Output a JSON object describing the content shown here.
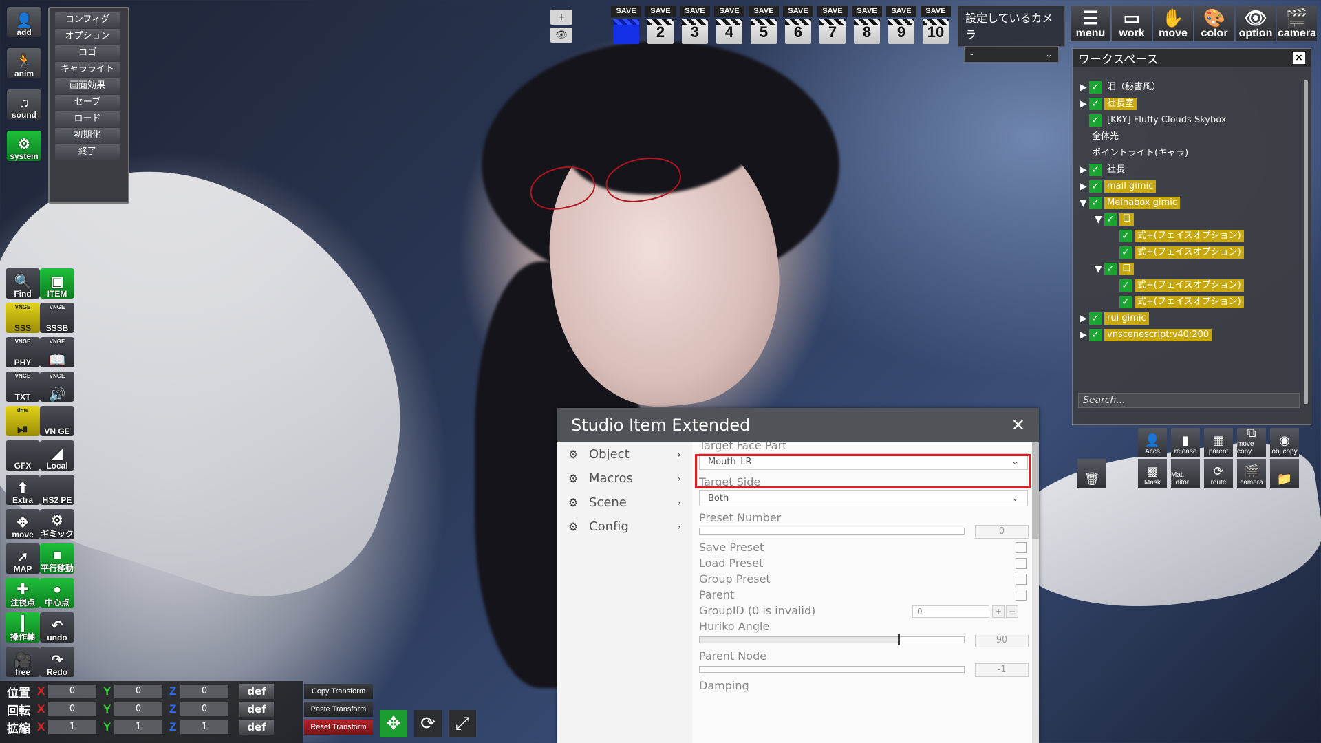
{
  "system_menu": {
    "items": [
      "コンフィグ",
      "オプション",
      "ロゴ",
      "キャラライト",
      "画面効果",
      "セーブ",
      "ロード",
      "初期化",
      "終了"
    ]
  },
  "left_toolbar": {
    "top": [
      {
        "label": "add",
        "icon": "add-person-icon"
      },
      {
        "label": "anim",
        "icon": "running-figure-icon"
      },
      {
        "label": "sound",
        "icon": "music-note-icon"
      },
      {
        "label": "system",
        "icon": "gear-icon"
      }
    ],
    "grid": [
      {
        "label": "Find",
        "small": "",
        "icon": "magnifier-icon"
      },
      {
        "label": "ITEM",
        "small": "",
        "icon": "item-icon"
      },
      {
        "label": "SSS",
        "small": "VNGE",
        "icon": ""
      },
      {
        "label": "SSSB",
        "small": "VNGE",
        "icon": ""
      },
      {
        "label": "PHY",
        "small": "VNGE",
        "icon": ""
      },
      {
        "label": "",
        "small": "VNGE",
        "icon": "book-icon"
      },
      {
        "label": "TXT",
        "small": "VNGE",
        "icon": ""
      },
      {
        "label": "",
        "small": "VNGE",
        "icon": "speaker-icon"
      },
      {
        "label": "",
        "small": "time",
        "icon": "play-pause-icon"
      },
      {
        "label": "VN GE",
        "small": "",
        "icon": ""
      },
      {
        "label": "GFX",
        "small": "",
        "icon": ""
      },
      {
        "label": "Local",
        "small": "",
        "icon": "local-icon"
      },
      {
        "label": "Extra",
        "small": "",
        "icon": "extra-icon"
      },
      {
        "label": "HS2 PE",
        "small": "",
        "icon": ""
      },
      {
        "label": "move",
        "small": "",
        "icon": "move-arrows-icon"
      },
      {
        "label": "ギミック",
        "small": "",
        "icon": "gear-icon"
      },
      {
        "label": "MAP",
        "small": "",
        "icon": "map-icon"
      },
      {
        "label": "平行移動",
        "small": "",
        "icon": "square-icon"
      },
      {
        "label": "注視点",
        "small": "",
        "icon": "crosshair-icon"
      },
      {
        "label": "中心点",
        "small": "",
        "icon": "circle-icon"
      },
      {
        "label": "操作軸",
        "small": "",
        "icon": "axis-icon"
      },
      {
        "label": "undo",
        "small": "",
        "icon": "undo-icon"
      },
      {
        "label": "free",
        "small": "",
        "icon": "camera-icon"
      },
      {
        "label": "Redo",
        "small": "",
        "icon": "redo-icon"
      }
    ]
  },
  "top_controls": {
    "plus": "+",
    "eye": "👁"
  },
  "save_bar": {
    "label": "SAVE",
    "slots": [
      "",
      "2",
      "3",
      "4",
      "5",
      "6",
      "7",
      "8",
      "9",
      "10"
    ],
    "active_index": 0
  },
  "camera_box": {
    "title": "設定しているカメラ",
    "value": "-"
  },
  "top_right": [
    {
      "label": "menu",
      "icon": "list-icon"
    },
    {
      "label": "work",
      "icon": "frame-icon"
    },
    {
      "label": "move",
      "icon": "hand-icon"
    },
    {
      "label": "color",
      "icon": "palette-icon"
    },
    {
      "label": "option",
      "icon": "eye-icon"
    },
    {
      "label": "camera",
      "icon": "clapper-icon"
    }
  ],
  "workspace": {
    "title": "ワークスペース",
    "close": "×",
    "search_placeholder": "Search...",
    "nodes": [
      {
        "label": "泪（秘書風）",
        "arrow": "▶",
        "check": true,
        "highlight": false,
        "indent": 0
      },
      {
        "label": "社長室",
        "arrow": "▶",
        "check": true,
        "highlight": true,
        "indent": 0
      },
      {
        "label": "[KKY] Fluffy Clouds Skybox",
        "arrow": "",
        "check": true,
        "highlight": false,
        "indent": 0
      },
      {
        "label": "全体光",
        "arrow": "",
        "check": false,
        "highlight": false,
        "indent": 0
      },
      {
        "label": "ポイントライト(キャラ)",
        "arrow": "",
        "check": false,
        "highlight": false,
        "indent": 0
      },
      {
        "label": "社長",
        "arrow": "▶",
        "check": true,
        "highlight": false,
        "indent": 0
      },
      {
        "label": "mail gimic",
        "arrow": "▶",
        "check": true,
        "highlight": true,
        "indent": 0
      },
      {
        "label": "Meinabox gimic",
        "arrow": "▼",
        "check": true,
        "highlight": true,
        "indent": 0
      },
      {
        "label": "目",
        "arrow": "▼",
        "check": true,
        "highlight": true,
        "indent": 1
      },
      {
        "label": "式+(フェイスオプション)",
        "arrow": "",
        "check": true,
        "highlight": true,
        "indent": 2
      },
      {
        "label": "式+(フェイスオプション)",
        "arrow": "",
        "check": true,
        "highlight": true,
        "indent": 2
      },
      {
        "label": "口",
        "arrow": "▼",
        "check": true,
        "highlight": true,
        "indent": 1
      },
      {
        "label": "式+(フェイスオプション)",
        "arrow": "",
        "check": true,
        "highlight": true,
        "indent": 2
      },
      {
        "label": "式+(フェイスオプション)",
        "arrow": "",
        "check": true,
        "highlight": true,
        "indent": 2
      },
      {
        "label": "rui gimic",
        "arrow": "▶",
        "check": true,
        "highlight": true,
        "indent": 0
      },
      {
        "label": "vnscenescript:v40:200",
        "arrow": "▶",
        "check": true,
        "highlight": true,
        "indent": 0
      }
    ],
    "buttons_row1": [
      {
        "label": "Accs",
        "icon": "person-icon"
      },
      {
        "label": "release",
        "icon": "bars-icon"
      },
      {
        "label": "parent",
        "icon": "grid-icon"
      },
      {
        "label": "move copy",
        "icon": "copy-icon"
      },
      {
        "label": "obj copy",
        "icon": "objects-icon"
      }
    ],
    "buttons_row2": [
      {
        "label": "",
        "icon": "trash-icon"
      },
      {
        "label": "Mask",
        "icon": "mask-icon"
      },
      {
        "label": "Mat. Editor",
        "icon": ""
      },
      {
        "label": "route",
        "icon": "route-icon"
      },
      {
        "label": "camera",
        "icon": "clapper-icon"
      },
      {
        "label": "",
        "icon": "folder-icon"
      }
    ]
  },
  "studio_item_extended": {
    "title": "Studio Item Extended",
    "close": "✕",
    "nav": [
      {
        "label": "Object",
        "icon": "gear-icon"
      },
      {
        "label": "Macros",
        "icon": "gear-icon"
      },
      {
        "label": "Scene",
        "icon": "gear-icon"
      },
      {
        "label": "Config",
        "icon": "gear-icon"
      }
    ],
    "fields": {
      "target_face_part_label": "Target Face Part",
      "target_face_part_value": "Mouth_LR",
      "target_side_label": "Target Side",
      "target_side_value": "Both",
      "preset_number_label": "Preset Number",
      "preset_number_value": "0",
      "preset_number_fraction": 0.0,
      "save_preset_label": "Save Preset",
      "load_preset_label": "Load Preset",
      "group_preset_label": "Group Preset",
      "parent_label": "Parent",
      "groupid_label": "GroupID (0 is invalid)",
      "groupid_value": "0",
      "groupid_plus": "+",
      "groupid_minus": "−",
      "huriko_angle_label": "Huriko Angle",
      "huriko_angle_value": "90",
      "huriko_angle_fraction": 0.75,
      "parent_node_label": "Parent Node",
      "parent_node_value": "-1",
      "parent_node_fraction": 0.0,
      "damping_label": "Damping"
    }
  },
  "transform": {
    "rows": [
      {
        "label": "位置",
        "x": "0",
        "y": "0",
        "z": "0"
      },
      {
        "label": "回転",
        "x": "0",
        "y": "0",
        "z": "0"
      },
      {
        "label": "拡縮",
        "x": "1",
        "y": "1",
        "z": "1"
      }
    ],
    "axis_x": "X",
    "axis_y": "Y",
    "axis_z": "Z",
    "def_label": "def",
    "copy": "Copy Transform",
    "paste": "Paste Transform",
    "reset": "Reset Transform",
    "icons": [
      "move-arrows-icon",
      "rotate-icon",
      "scale-icon"
    ]
  }
}
